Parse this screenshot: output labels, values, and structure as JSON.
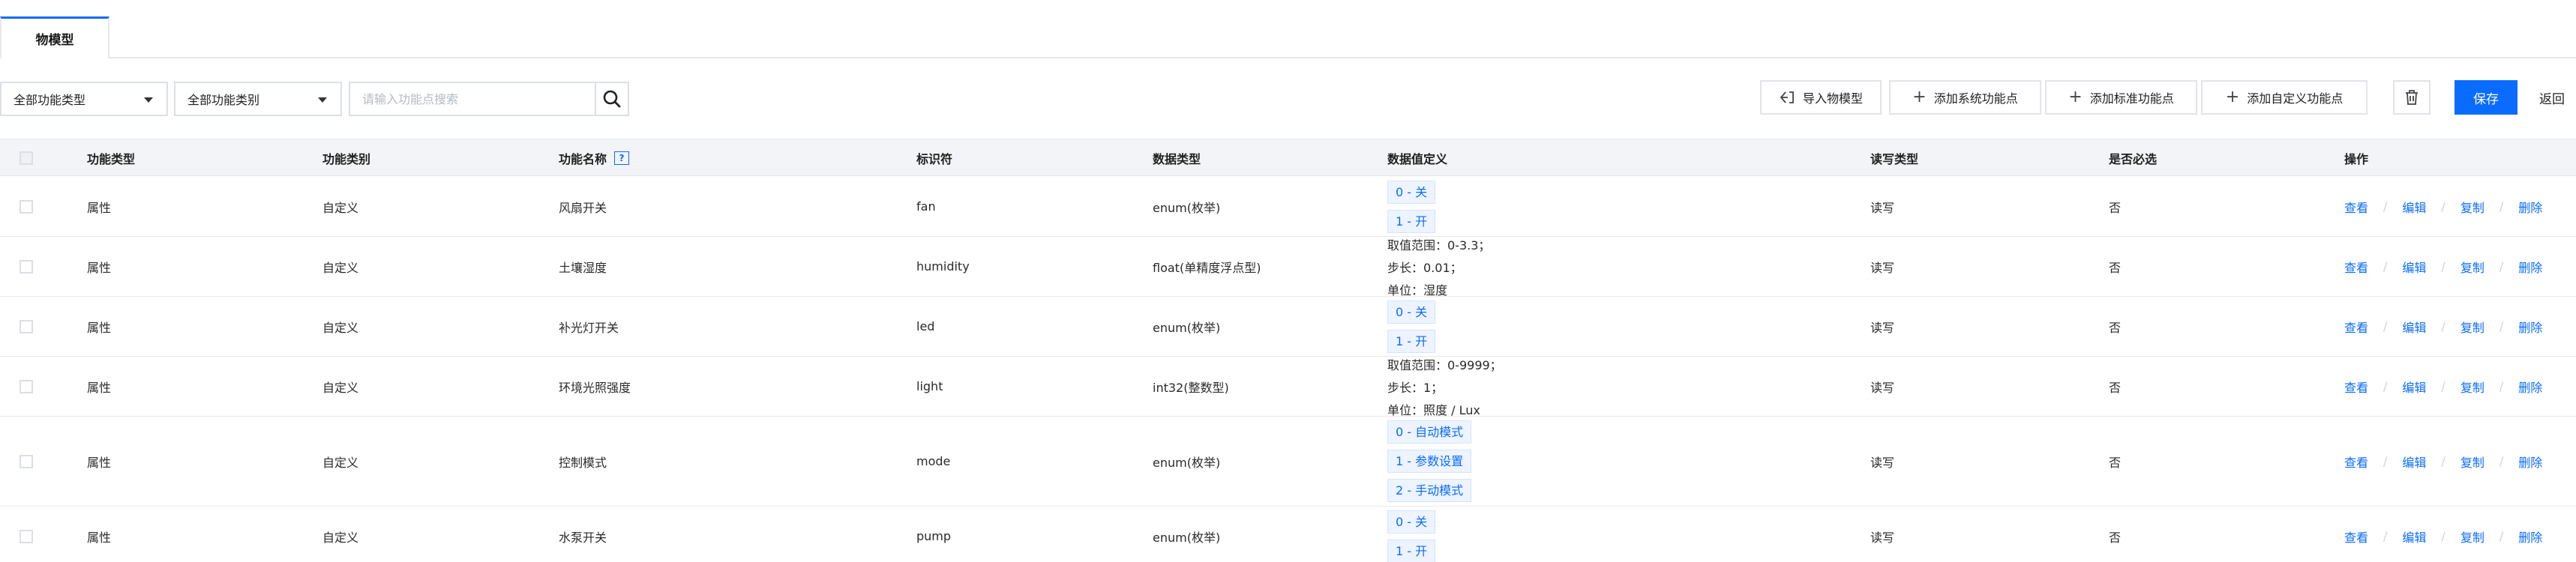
{
  "tabs": [
    {
      "label": "物模型",
      "active": true
    }
  ],
  "filters": {
    "type_select": "全部功能类型",
    "category_select": "全部功能类别",
    "search_placeholder": "请输入功能点搜索"
  },
  "toolbar": {
    "import_label": "导入物模型",
    "add_system_label": "添加系统功能点",
    "add_standard_label": "添加标准功能点",
    "add_custom_label": "添加自定义功能点",
    "save_label": "保存",
    "back_label": "返回"
  },
  "table": {
    "headers": {
      "type": "功能类型",
      "category": "功能类别",
      "name": "功能名称",
      "identifier": "标识符",
      "data_type": "数据类型",
      "definition": "数据值定义",
      "rw": "读写类型",
      "required": "是否必选",
      "actions": "操作"
    },
    "action_labels": {
      "view": "查看",
      "edit": "编辑",
      "copy": "复制",
      "delete": "删除",
      "separator": "/"
    },
    "rows": [
      {
        "type": "属性",
        "category": "自定义",
        "name": "风扇开关",
        "identifier": "fan",
        "data_type": "enum(枚举)",
        "enums": [
          "0 - 关",
          "1 - 开"
        ],
        "rw": "读写",
        "required": "否"
      },
      {
        "type": "属性",
        "category": "自定义",
        "name": "土壤湿度",
        "identifier": "humidity",
        "data_type": "float(单精度浮点型)",
        "range": [
          "取值范围：0-3.3；",
          "步长：0.01；",
          "单位：湿度"
        ],
        "rw": "读写",
        "required": "否"
      },
      {
        "type": "属性",
        "category": "自定义",
        "name": "补光灯开关",
        "identifier": "led",
        "data_type": "enum(枚举)",
        "enums": [
          "0 - 关",
          "1 - 开"
        ],
        "rw": "读写",
        "required": "否"
      },
      {
        "type": "属性",
        "category": "自定义",
        "name": "环境光照强度",
        "identifier": "light",
        "data_type": "int32(整数型)",
        "range": [
          "取值范围：0-9999；",
          "步长：1；",
          "单位：照度 / Lux"
        ],
        "rw": "读写",
        "required": "否"
      },
      {
        "type": "属性",
        "category": "自定义",
        "name": "控制模式",
        "identifier": "mode",
        "data_type": "enum(枚举)",
        "enums": [
          "0 - 自动模式",
          "1 - 参数设置",
          "2 - 手动模式"
        ],
        "rw": "读写",
        "required": "否"
      },
      {
        "type": "属性",
        "category": "自定义",
        "name": "水泵开关",
        "identifier": "pump",
        "data_type": "enum(枚举)",
        "enums": [
          "0 - 关",
          "1 - 开"
        ],
        "rw": "读写",
        "required": "否"
      }
    ]
  },
  "icons": {
    "search": "search-icon",
    "import": "import-icon",
    "add": "plus-icon",
    "delete": "trash-icon",
    "help": "help-icon",
    "caret": "caret-down-icon"
  },
  "colors": {
    "accent": "#0a6cff",
    "header_bg": "#f2f4f8",
    "tag_bg": "#edf4ff"
  }
}
